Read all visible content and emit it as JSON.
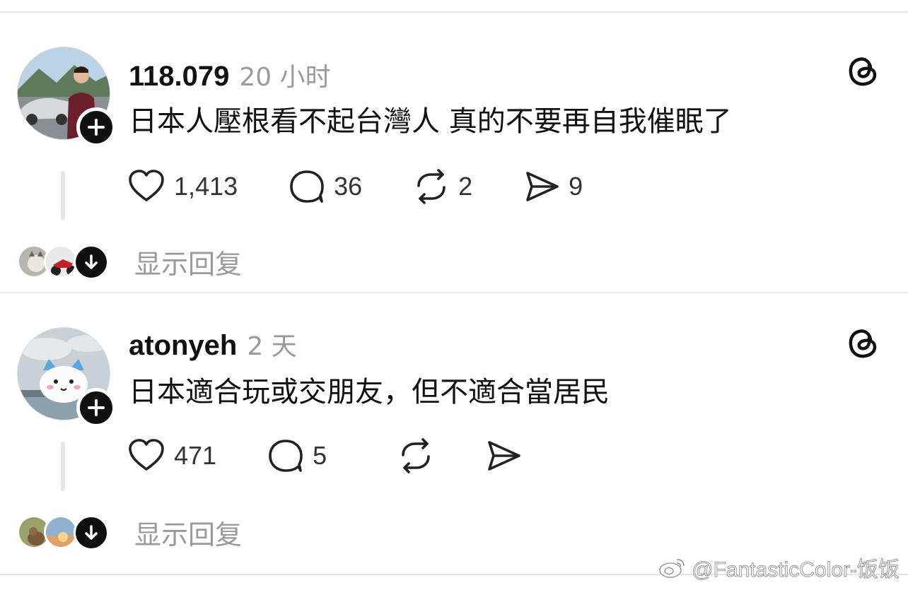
{
  "posts": [
    {
      "username": "118.079",
      "timestamp": "20 小时",
      "text": "日本人壓根看不起台灣人 真的不要再自我催眠了",
      "likes": "1,413",
      "comments": "36",
      "reposts": "2",
      "shares": "9",
      "show_replies": "显示回复",
      "avatar_icon": "man-with-car-avatar"
    },
    {
      "username": "atonyeh",
      "timestamp": "2 天",
      "text": "日本適合玩或交朋友，但不適合當居民",
      "likes": "471",
      "comments": "5",
      "reposts": "",
      "shares": "",
      "show_replies": "显示回复",
      "avatar_icon": "cartoon-cat-balloon-avatar"
    }
  ],
  "watermark": {
    "text": "@FantasticColor-饭饭",
    "icon": "weibo-icon"
  },
  "colors": {
    "text": "#111111",
    "muted": "#9a9a9a",
    "divider": "#e5e5e5",
    "icon": "#222222"
  }
}
